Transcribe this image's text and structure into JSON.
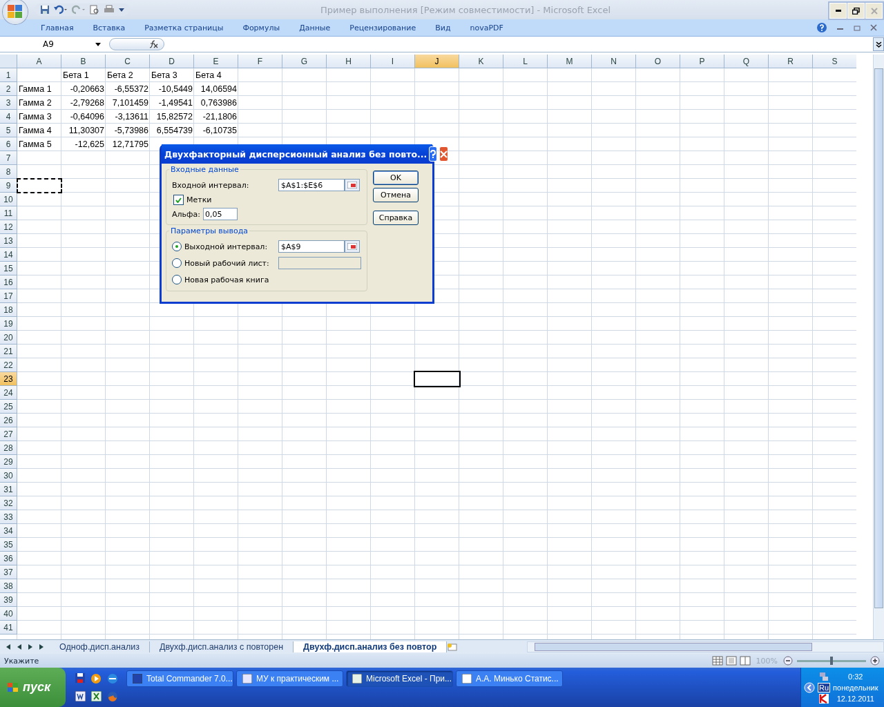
{
  "window": {
    "title": "Пример выполнения  [Режим совместимости]  -  Microsoft Excel"
  },
  "ribbon_tabs": [
    "Главная",
    "Вставка",
    "Разметка страницы",
    "Формулы",
    "Данные",
    "Рецензирование",
    "Вид",
    "novaPDF"
  ],
  "name_box": "A9",
  "columns": [
    {
      "label": "A",
      "selected": false
    },
    {
      "label": "B",
      "selected": false
    },
    {
      "label": "C",
      "selected": false
    },
    {
      "label": "D",
      "selected": false
    },
    {
      "label": "E",
      "selected": false
    },
    {
      "label": "F",
      "selected": false
    },
    {
      "label": "G",
      "selected": false
    },
    {
      "label": "H",
      "selected": false
    },
    {
      "label": "I",
      "selected": false
    },
    {
      "label": "J",
      "selected": true
    },
    {
      "label": "K",
      "selected": false
    },
    {
      "label": "L",
      "selected": false
    },
    {
      "label": "M",
      "selected": false
    },
    {
      "label": "N",
      "selected": false
    },
    {
      "label": "O",
      "selected": false
    },
    {
      "label": "P",
      "selected": false
    },
    {
      "label": "Q",
      "selected": false
    },
    {
      "label": "R",
      "selected": false
    },
    {
      "label": "S",
      "selected": false
    }
  ],
  "rows": [
    {
      "n": "1",
      "cells": [
        "",
        "Бета 1",
        "Бета 2",
        "Бета 3",
        "Бета 4"
      ]
    },
    {
      "n": "2",
      "cells": [
        "Гамма 1",
        "-0,20663",
        "-6,55372",
        "-10,5449",
        "14,06594"
      ]
    },
    {
      "n": "3",
      "cells": [
        "Гамма 2",
        "-2,79268",
        "7,101459",
        "-1,49541",
        "0,763986"
      ]
    },
    {
      "n": "4",
      "cells": [
        "Гамма 3",
        "-0,64096",
        "-3,13611",
        "15,82572",
        "-21,1806"
      ]
    },
    {
      "n": "5",
      "cells": [
        "Гамма 4",
        "11,30307",
        "-5,73986",
        "6,554739",
        "-6,10735"
      ]
    },
    {
      "n": "6",
      "cells": [
        "Гамма 5",
        "-12,625",
        "12,71795"
      ]
    },
    {
      "n": "7"
    },
    {
      "n": "8"
    },
    {
      "n": "9",
      "marquee": true
    },
    {
      "n": "10"
    },
    {
      "n": "11"
    },
    {
      "n": "12"
    },
    {
      "n": "13"
    },
    {
      "n": "14"
    },
    {
      "n": "15"
    },
    {
      "n": "16"
    },
    {
      "n": "17"
    },
    {
      "n": "18"
    },
    {
      "n": "19"
    },
    {
      "n": "20"
    },
    {
      "n": "21"
    },
    {
      "n": "22"
    },
    {
      "n": "23",
      "active": true
    },
    {
      "n": "24"
    },
    {
      "n": "25"
    },
    {
      "n": "26"
    },
    {
      "n": "27"
    },
    {
      "n": "28"
    },
    {
      "n": "29"
    },
    {
      "n": "30"
    },
    {
      "n": "31"
    },
    {
      "n": "32"
    },
    {
      "n": "33"
    },
    {
      "n": "34"
    },
    {
      "n": "35"
    },
    {
      "n": "36"
    },
    {
      "n": "37"
    },
    {
      "n": "38"
    },
    {
      "n": "39"
    },
    {
      "n": "40"
    },
    {
      "n": "41"
    }
  ],
  "dialog": {
    "title": "Двухфакторный дисперсионный анализ без повто...",
    "input_group": {
      "title": "Входные данные",
      "range_label": "Входной интервал:",
      "range_value": "$A$1:$E$6",
      "labels_checkbox": {
        "label": "Метки",
        "checked": true
      },
      "alpha_label": "Альфа:",
      "alpha_value": "0,05"
    },
    "output_group": {
      "title": "Параметры вывода",
      "options": [
        {
          "kind": "range",
          "label": "Выходной интервал:",
          "selected": true,
          "value": "$A$9"
        },
        {
          "kind": "field",
          "label": "Новый рабочий лист:",
          "selected": false
        },
        {
          "kind": "plain",
          "label": "Новая рабочая книга",
          "selected": false
        }
      ]
    },
    "buttons": [
      "OK",
      "Отмена",
      "Справка"
    ]
  },
  "sheet_tabs": [
    {
      "label": "Одноф.дисп.анализ",
      "selected": false
    },
    {
      "label": "Двухф.дисп.анализ с повторен",
      "selected": false
    },
    {
      "label": "Двухф.дисп.анализ без повтор",
      "selected": true
    }
  ],
  "status_bar": {
    "mode": "Укажите",
    "zoom": "100%",
    "zoom_slider": {
      "level": 0.5
    }
  },
  "taskbar": {
    "start": "пуск",
    "tasks": [
      {
        "label": "Total Commander 7.0...",
        "selected": false
      },
      {
        "label": "МУ к практическим ...",
        "selected": false
      },
      {
        "label": "Microsoft Excel - При...",
        "selected": true
      },
      {
        "label": "А.А. Минько Статис...",
        "selected": false
      }
    ],
    "language": "Ru",
    "time": "0:32",
    "day": "понедельник",
    "date": "12.12.2011"
  }
}
